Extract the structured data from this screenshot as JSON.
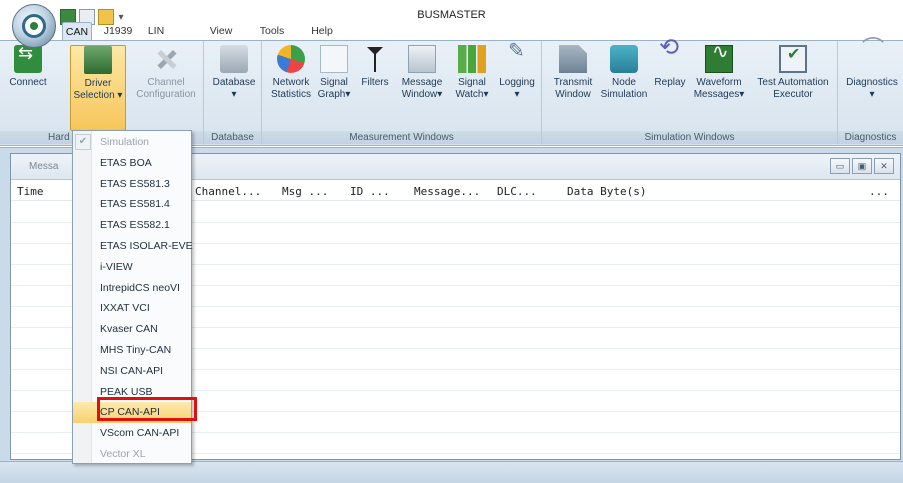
{
  "app": {
    "title": "BUSMASTER"
  },
  "ribbon_tabs": [
    "CAN",
    "J1939",
    "LIN",
    "View",
    "Tools",
    "Help"
  ],
  "ribbon": {
    "connect": "Connect",
    "driver_selection": [
      "Driver",
      "Selection"
    ],
    "channel_configuration": [
      "Channel",
      "Configuration"
    ],
    "database": "Database",
    "network_statistics": [
      "Network",
      "Statistics"
    ],
    "signal_graph": [
      "Signal",
      "Graph"
    ],
    "filters": "Filters",
    "message_window": [
      "Message",
      "Window"
    ],
    "signal_watch": [
      "Signal",
      "Watch"
    ],
    "logging": "Logging",
    "transmit_window": [
      "Transmit",
      "Window"
    ],
    "node_simulation": [
      "Node",
      "Simulation"
    ],
    "replay": "Replay",
    "waveform_messages": [
      "Waveform",
      "Messages"
    ],
    "test_automation_executor": [
      "Test Automation",
      "Executor"
    ],
    "diagnostics": "Diagnostics",
    "groups": {
      "hardware": "Hard",
      "database": "Database",
      "measurement_windows": "Measurement Windows",
      "simulation_windows": "Simulation Windows",
      "diagnostics": "Diagnostics"
    }
  },
  "message_window": {
    "title": "Messa",
    "columns": [
      "Time",
      "Channel...",
      "Msg ...",
      "ID ...",
      "Message...",
      "DLC...",
      "Data Byte(s)",
      "..."
    ]
  },
  "driver_menu": {
    "items": [
      {
        "label": "Simulation",
        "state": "disabled",
        "checked": true
      },
      {
        "label": "ETAS BOA",
        "state": "normal"
      },
      {
        "label": "ETAS ES581.3",
        "state": "normal"
      },
      {
        "label": "ETAS ES581.4",
        "state": "normal"
      },
      {
        "label": "ETAS ES582.1",
        "state": "normal"
      },
      {
        "label": "ETAS ISOLAR-EVE",
        "state": "normal"
      },
      {
        "label": "i-VIEW",
        "state": "normal"
      },
      {
        "label": "IntrepidCS neoVI",
        "state": "normal"
      },
      {
        "label": "IXXAT VCI",
        "state": "normal"
      },
      {
        "label": "Kvaser CAN",
        "state": "normal"
      },
      {
        "label": "MHS Tiny-CAN",
        "state": "normal"
      },
      {
        "label": "NSI CAN-API",
        "state": "normal"
      },
      {
        "label": "PEAK USB",
        "state": "normal"
      },
      {
        "label": "CP CAN-API",
        "state": "hover"
      },
      {
        "label": "VScom CAN-API",
        "state": "normal"
      },
      {
        "label": "Vector XL",
        "state": "disabled"
      }
    ]
  },
  "colors": {
    "highlight": "#e01010",
    "ribbon": "#d7e3ee",
    "selected": "#f6c65a"
  }
}
